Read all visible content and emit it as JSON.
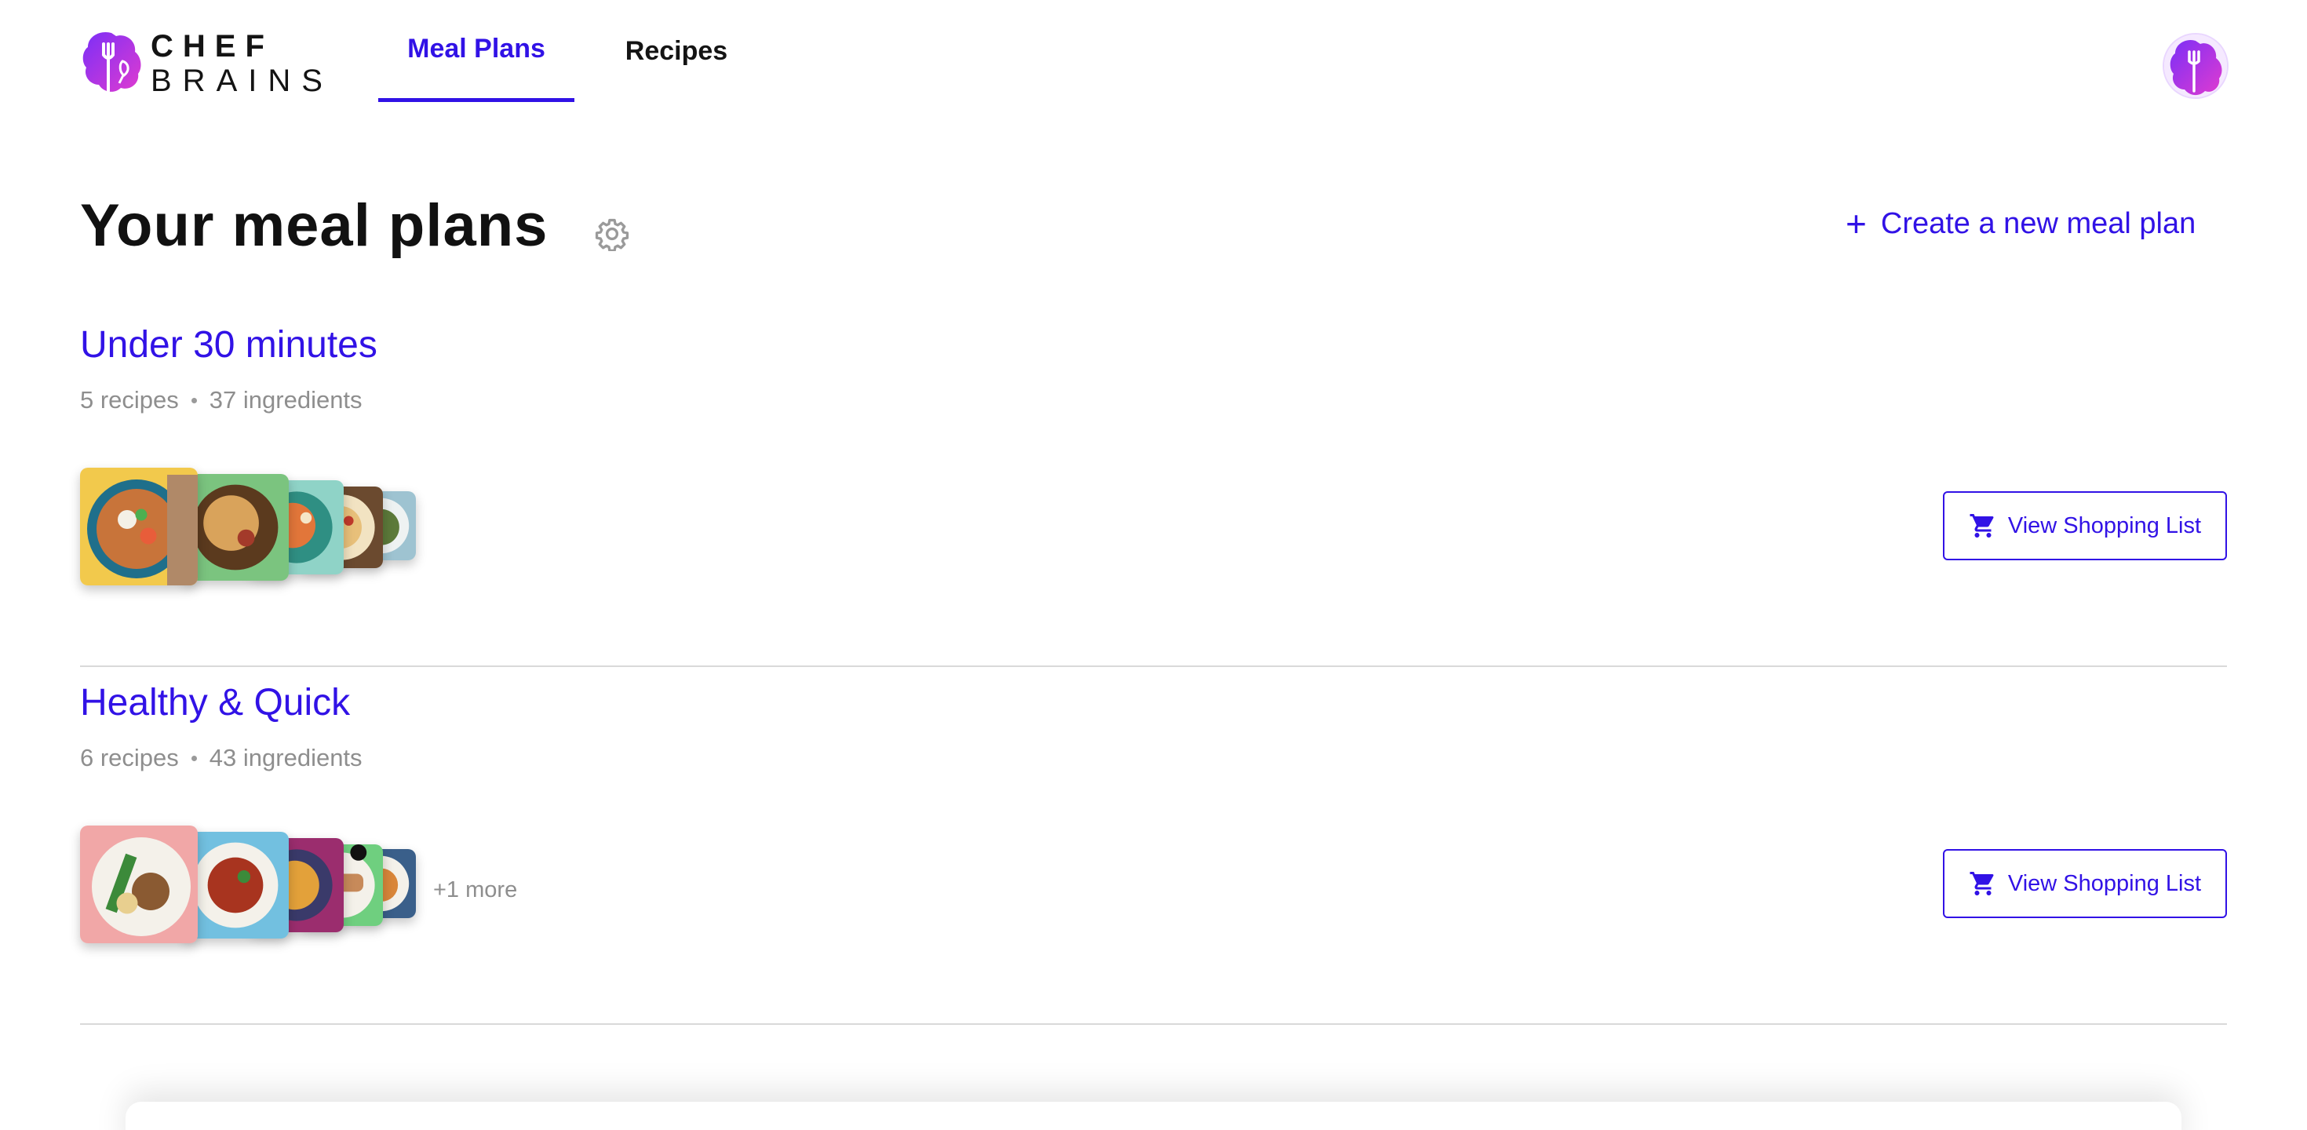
{
  "brand": {
    "line1": "CHEF",
    "line2": "BRAINS",
    "accent": "#3112e6",
    "gradient": [
      "#7b2ff7",
      "#e03bd0"
    ]
  },
  "nav": {
    "tabs": [
      {
        "label": "Meal Plans",
        "active": true
      },
      {
        "label": "Recipes",
        "active": false
      }
    ]
  },
  "header": {
    "title": "Your meal plans",
    "settings_icon": "gear-icon",
    "create_label": "Create a new meal plan",
    "create_icon": "plus-icon"
  },
  "plans": [
    {
      "name": "Under 30 minutes",
      "recipes": "5 recipes",
      "ingredients": "37 ingredients",
      "more": "",
      "button_label": "View Shopping List"
    },
    {
      "name": "Healthy & Quick",
      "recipes": "6 recipes",
      "ingredients": "43 ingredients",
      "more": "+1 more",
      "button_label": "View Shopping List"
    }
  ]
}
